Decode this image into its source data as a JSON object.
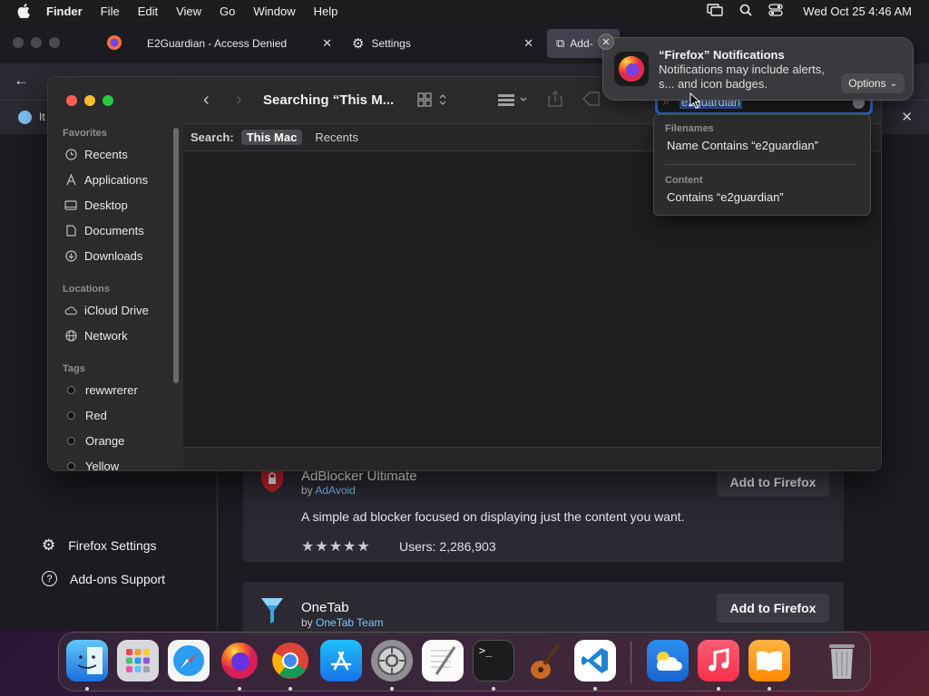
{
  "menubar": {
    "app_name": "Finder",
    "items": [
      "File",
      "Edit",
      "View",
      "Go",
      "Window",
      "Help"
    ],
    "clock": "Wed Oct 25  4:46 AM"
  },
  "firefox": {
    "tabs": [
      {
        "label": "E2Guardian - Access Denied"
      },
      {
        "label": "Settings"
      },
      {
        "label": "Add-"
      }
    ],
    "notice_text": "It",
    "sidebar": {
      "settings_label": "Firefox Settings",
      "support_label": "Add-ons Support"
    },
    "addons": [
      {
        "title": "AdBlocker Ultimate",
        "by_prefix": "by",
        "author": "AdAvoid",
        "description": "A simple ad blocker focused on displaying just the content you want.",
        "stars": "★★★★★",
        "rating": 5,
        "users": "Users: 2,286,903",
        "button": "Add to Firefox"
      },
      {
        "title": "OneTab",
        "by_prefix": "by",
        "author": "OneTab Team",
        "button": "Add to Firefox"
      }
    ]
  },
  "finder": {
    "title": "Searching “This M...",
    "sidebar": {
      "favorites_header": "Favorites",
      "favorites": [
        "Recents",
        "Applications",
        "Desktop",
        "Documents",
        "Downloads"
      ],
      "locations_header": "Locations",
      "locations": [
        "iCloud Drive",
        "Network"
      ],
      "tags_header": "Tags",
      "tags": [
        "rewwrerer",
        "Red",
        "Orange",
        "Yellow"
      ]
    },
    "search": {
      "query": "e2guardian",
      "scope_label": "Search:",
      "scope_options": [
        "This Mac",
        "Recents"
      ]
    },
    "suggestions": {
      "filenames_header": "Filenames",
      "filename_option": "Name Contains “e2guardian”",
      "content_header": "Content",
      "content_option": "Contains “e2guardian”"
    }
  },
  "notification": {
    "title": "“Firefox” Notifications",
    "body": "Notifications may include alerts, s... and icon badges.",
    "options_label": "Options"
  },
  "dock": {
    "apps": [
      "Finder",
      "Launchpad",
      "Safari",
      "Firefox",
      "Chrome",
      "App Store",
      "System Settings",
      "TextEdit",
      "Terminal",
      "GarageBand",
      "Visual Studio Code",
      "Weather",
      "Music",
      "Books",
      "Trash"
    ]
  }
}
